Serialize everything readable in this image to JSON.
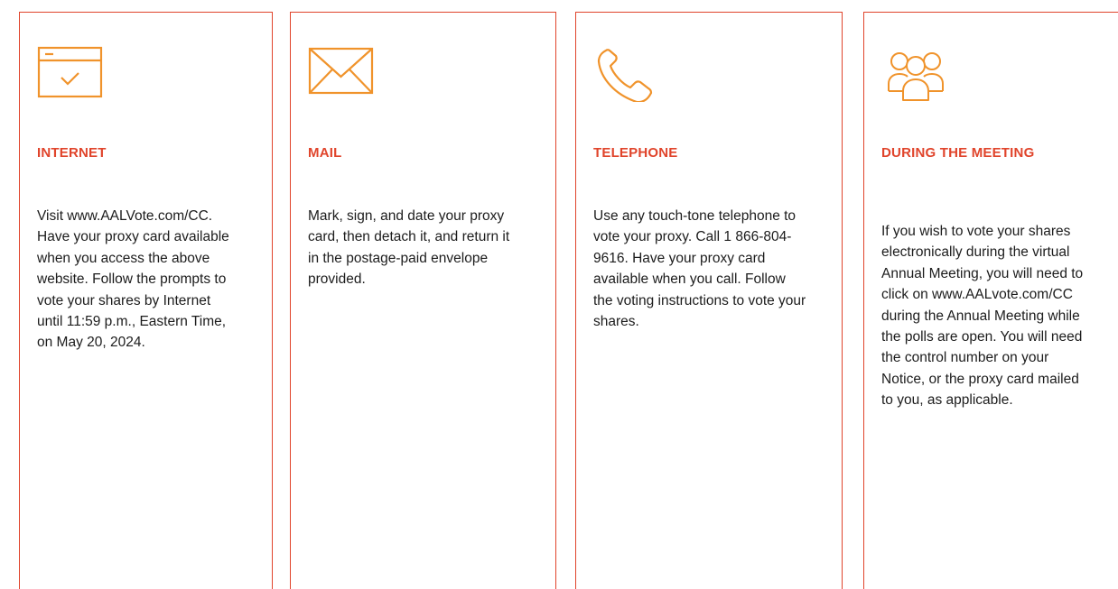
{
  "colors": {
    "accent": "#e0442b",
    "icon": "#f0932b",
    "text": "#1c1c1c",
    "border": "#e0442b"
  },
  "methods": [
    {
      "icon": "browser-window-check-icon",
      "heading": "INTERNET",
      "body": "Visit www.AALVote.com/CC. Have your proxy card available when you access the above website. Follow the prompts to vote your shares by Internet until 11:59 p.m., Eastern Time, on May 20, 2024."
    },
    {
      "icon": "envelope-icon",
      "heading": "MAIL",
      "body": "Mark, sign, and date your proxy card, then detach it, and return it in the postage-paid envelope provided."
    },
    {
      "icon": "telephone-icon",
      "heading": "TELEPHONE",
      "body": "Use any touch-tone telephone to vote your proxy. Call 1 866-804-9616. Have your proxy card available when you call. Follow the voting instructions to vote your shares."
    },
    {
      "icon": "people-group-icon",
      "heading": "DURING THE MEETING",
      "body": "If you wish to vote your shares electronically during the virtual Annual Meeting, you will need to click on www.AALvote.com/CC during the Annual Meeting while the polls are open. You will need the control number on your Notice, or the proxy card mailed to you, as applicable."
    }
  ]
}
